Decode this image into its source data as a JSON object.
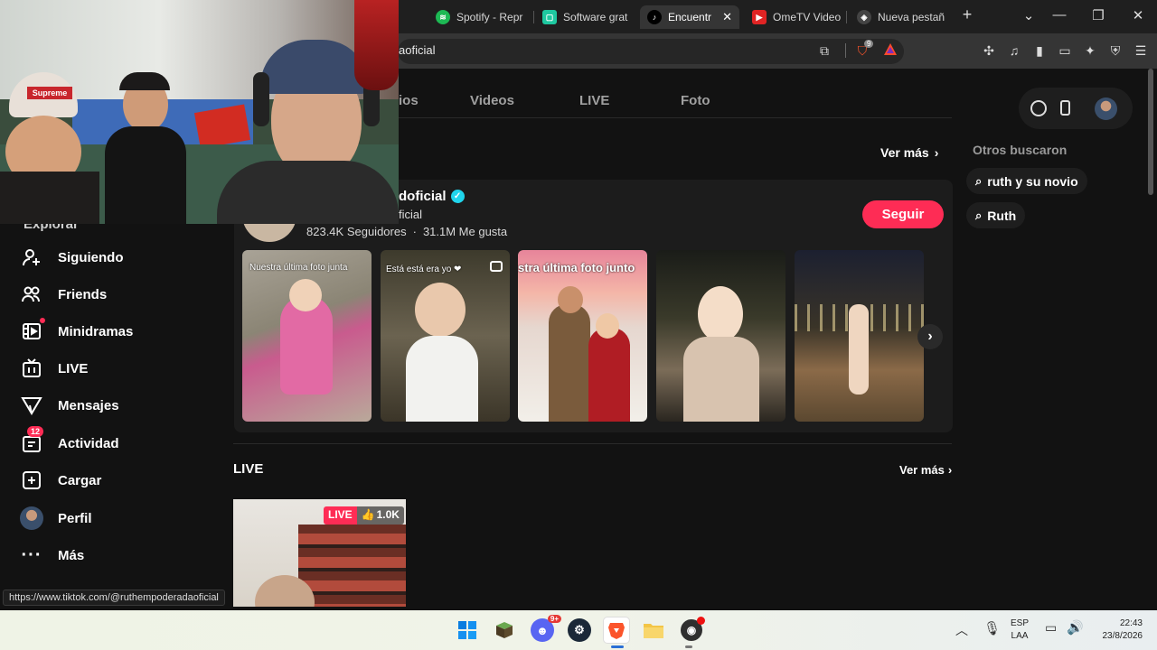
{
  "browser": {
    "tabs": [
      {
        "label": "Spotify - Repr",
        "color": "#1db954"
      },
      {
        "label": "Software grat",
        "color": "#1ec8a0"
      },
      {
        "label": "Encuentr",
        "color": "#111111"
      },
      {
        "label": "OmeTV Video",
        "color": "#e02424"
      },
      {
        "label": "Nueva pestañ",
        "color": "#666666"
      }
    ],
    "new_tab": "+",
    "url": "aoficial",
    "badge_count": "9"
  },
  "sidebar": {
    "items": [
      {
        "label": "Siguiendo",
        "icon": "following-icon"
      },
      {
        "label": "Friends",
        "icon": "friends-icon"
      },
      {
        "label": "Minidramas",
        "icon": "minidramas-icon"
      },
      {
        "label": "LIVE",
        "icon": "live-icon"
      },
      {
        "label": "Mensajes",
        "icon": "messages-icon"
      },
      {
        "label": "Actividad",
        "icon": "activity-icon",
        "badge": "12"
      },
      {
        "label": "Cargar",
        "icon": "upload-icon"
      },
      {
        "label": "Perfil",
        "icon": "avatar"
      },
      {
        "label": "Más",
        "icon": "more-icon"
      }
    ],
    "explore_partial": "Explorar"
  },
  "nav_tabs": [
    "ios",
    "Videos",
    "LIVE",
    "Foto"
  ],
  "accounts": {
    "see_more": "Ver más"
  },
  "user": {
    "name": "doficial",
    "handle": "ficial",
    "followers": "823.4K Seguidores",
    "dot": "·",
    "likes": "31.1M Me gusta",
    "follow_label": "Seguir"
  },
  "thumbs": [
    {
      "caption": "Nuestra última foto junta"
    },
    {
      "caption": "Está está era yo ❤"
    },
    {
      "caption": "stra última foto junto"
    },
    {
      "caption": ""
    },
    {
      "caption": ""
    }
  ],
  "live_section": {
    "title": "LIVE",
    "see_more": "Ver más",
    "badge": "LIVE",
    "likes": "1.0K"
  },
  "right_panel": {
    "title": "Otros buscaron",
    "suggestions": [
      "ruth y su novio",
      "Ruth"
    ]
  },
  "status_url": "https://www.tiktok.com/@ruthempoderadaoficial",
  "taskbar": {
    "lang_top": "ESP",
    "lang_bottom": "LAA",
    "time": "22:43",
    "date": "23/8/2026",
    "discord_badge": "9+"
  },
  "colors": {
    "accent": "#fe2c55",
    "verified": "#20d5ec",
    "sidebar_bg": "#121212",
    "card_bg": "#1c1c1c"
  }
}
